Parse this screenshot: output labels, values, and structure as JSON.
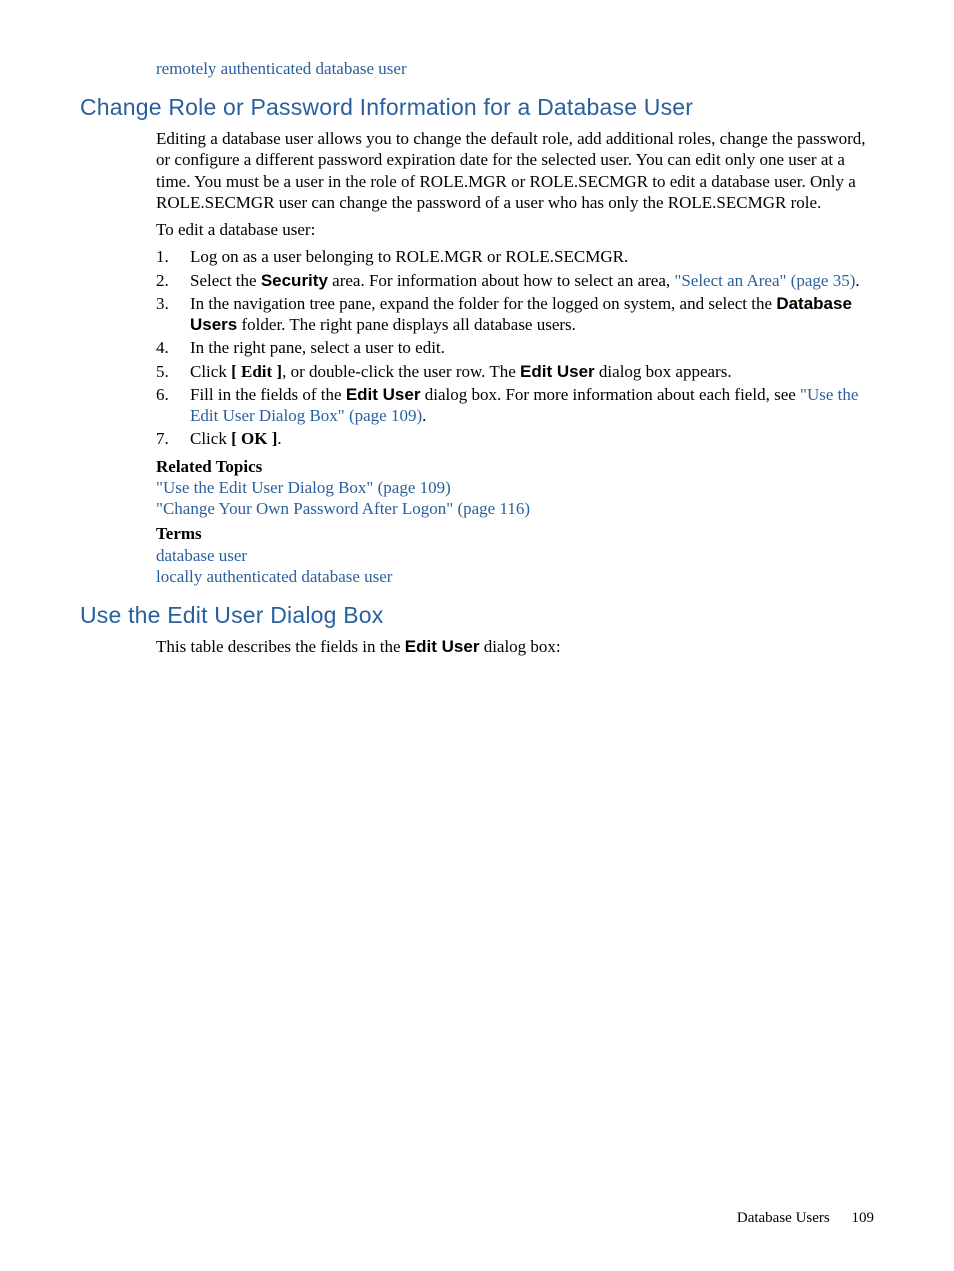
{
  "top_link": "remotely authenticated database user",
  "section1": {
    "title": "Change Role or Password Information for a Database User",
    "para1": "Editing a database user allows you to change the default role, add additional roles, change the password, or configure a different password expiration date for the selected user. You can edit only one user at a time. You must be a user in the role of ROLE.MGR or ROLE.SECMGR to edit a database user. Only a ROLE.SECMGR user can change the password of a user who has only the ROLE.SECMGR role.",
    "para2": "To edit a database user:",
    "steps": {
      "s1": "Log on as a user belonging to ROLE.MGR or ROLE.SECMGR.",
      "s2a": "Select the ",
      "s2b": "Security",
      "s2c": " area. For information about how to select an area, ",
      "s2link": "\"Select an Area\" (page 35)",
      "s2d": ".",
      "s3a": "In the navigation tree pane, expand the folder for the logged on system, and select the ",
      "s3b": "Database Users",
      "s3c": " folder. The right pane displays all database users.",
      "s4": "In the right pane, select a user to edit.",
      "s5a": "Click ",
      "s5b": "[ Edit ]",
      "s5c": ", or double-click the user row. The ",
      "s5d": "Edit User",
      "s5e": " dialog box appears.",
      "s6a": "Fill in the fields of the ",
      "s6b": "Edit User",
      "s6c": " dialog box. For more information about each field, see ",
      "s6link": "\"Use the Edit User Dialog Box\" (page 109)",
      "s6d": ".",
      "s7a": "Click ",
      "s7b": "[ OK ]",
      "s7c": "."
    },
    "related_heading": "Related Topics",
    "related_link1": "\"Use the Edit User Dialog Box\" (page 109)",
    "related_link2": "\"Change Your Own Password After Logon\" (page 116)",
    "terms_heading": "Terms",
    "term1": "database user",
    "term2": "locally authenticated database user"
  },
  "section2": {
    "title": "Use the Edit User Dialog Box",
    "para1a": "This table describes the fields in the ",
    "para1b": "Edit User",
    "para1c": " dialog box:"
  },
  "footer": {
    "section": "Database Users",
    "page": "109"
  }
}
